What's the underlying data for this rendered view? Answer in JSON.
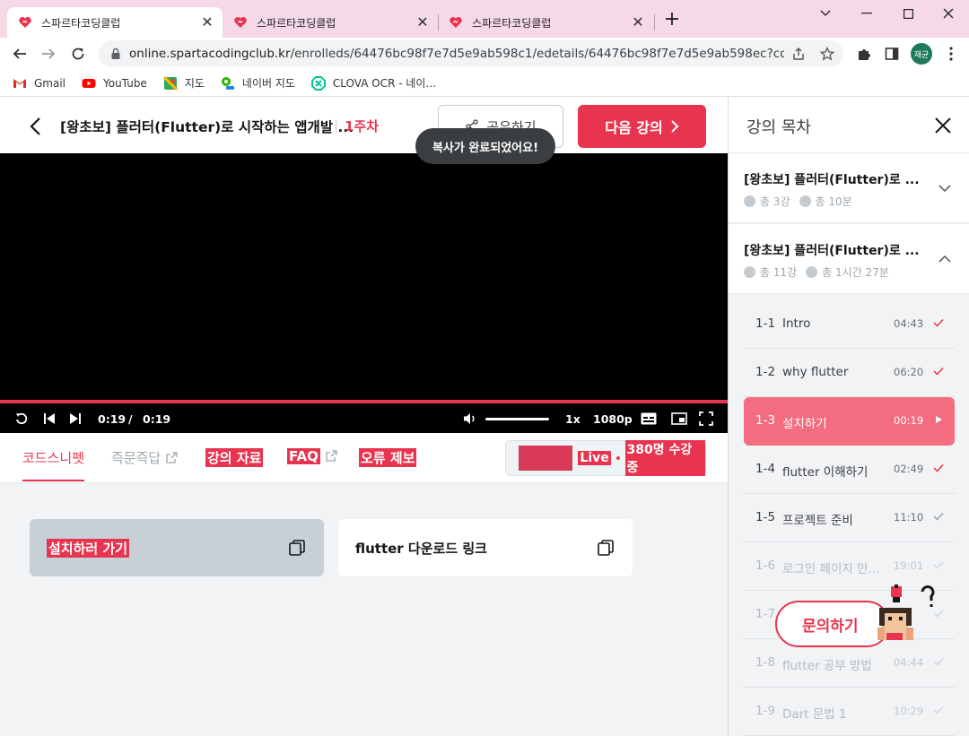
{
  "browser": {
    "tabs": [
      {
        "title": "스파르타코딩클럽",
        "active": true
      },
      {
        "title": "스파르타코딩클럽",
        "active": false
      },
      {
        "title": "스파르타코딩클럽",
        "active": false
      }
    ],
    "new_tab": "+",
    "url_host": "online.spartacodingclub.kr",
    "url_path": "/enrolleds/64476bc98f7e7d5e9ab598c1/edetails/64476bc98f7e7d5e9ab598ec?course_i...",
    "profile_initials": "재균",
    "bookmarks": [
      "Gmail",
      "YouTube",
      "지도",
      "네이버 지도",
      "CLOVA OCR - 네이..."
    ]
  },
  "header": {
    "title": "[왕초보] 플러터(Flutter)로 시작하는 앱개발 ...",
    "week": "1주차",
    "share_label": "공유하기",
    "next_label": "다음 강의",
    "toast": "복사가 완료되었어요!"
  },
  "player": {
    "current_time": "0:19",
    "separator": "/",
    "duration": "0:19",
    "speed": "1x",
    "quality": "1080p",
    "progress": 1.0,
    "volume": 1.0
  },
  "content_tabs": [
    {
      "label": "코드스니펫",
      "active": true
    },
    {
      "label": "즉문즉답",
      "external": true
    },
    {
      "label": "강의 자료",
      "highlighted": true
    },
    {
      "label": "FAQ",
      "external": true,
      "highlighted": true
    },
    {
      "label": "오류 제보",
      "highlighted": true
    }
  ],
  "live": {
    "label": "Live",
    "count_text": "380명 수강 중"
  },
  "snippets": [
    {
      "label": "설치하러 가기"
    },
    {
      "label": "flutter 다운로드 링크"
    }
  ],
  "sidebar": {
    "title": "강의 목차",
    "chapters": [
      {
        "title": "[왕초보] 플러터(Flutter)로 ...",
        "count": "총 3강",
        "time": "총 10분",
        "expanded": false
      },
      {
        "title": "[왕초보] 플러터(Flutter)로 ...",
        "count": "총 11강",
        "time": "총 1시간 27분",
        "expanded": true
      }
    ],
    "lessons": [
      {
        "num": "1-1",
        "title": "Intro",
        "duration": "04:43",
        "state": "done"
      },
      {
        "num": "1-2",
        "title": "why flutter",
        "duration": "06:20",
        "state": "done"
      },
      {
        "num": "1-3",
        "title": "설치하기",
        "duration": "00:19",
        "state": "current"
      },
      {
        "num": "1-4",
        "title": "flutter 이해하기",
        "duration": "02:49",
        "state": "done"
      },
      {
        "num": "1-5",
        "title": "프로젝트 준비",
        "duration": "11:10",
        "state": "viewed"
      },
      {
        "num": "1-6",
        "title": "로그인 페이지 만...",
        "duration": "19:01",
        "state": "locked"
      },
      {
        "num": "1-7",
        "title": "",
        "duration": "",
        "state": "locked"
      },
      {
        "num": "1-8",
        "title": "flutter 공부 방법",
        "duration": "04:44",
        "state": "locked"
      },
      {
        "num": "1-9",
        "title": "Dart 문법 1",
        "duration": "10:29",
        "state": "locked"
      }
    ]
  },
  "inquiry_label": "문의하기",
  "colors": {
    "accent": "#e8344e",
    "current_lesson": "#f36c7f",
    "tab_strip": "#f6d9e6"
  }
}
